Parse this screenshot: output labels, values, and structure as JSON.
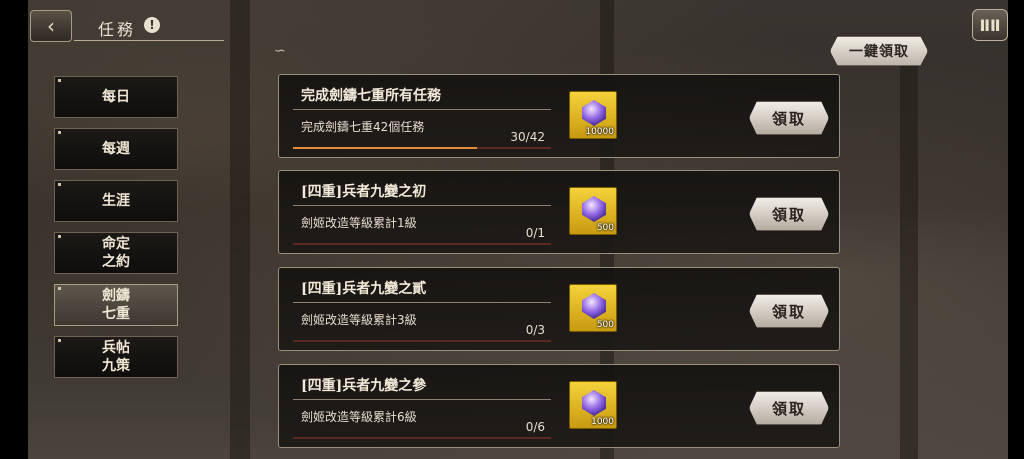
{
  "header": {
    "title": "任務",
    "info_icon": "!",
    "back_icon": "back-arrow",
    "menu_icon": "menu-grid",
    "claim_all_label": "一鍵領取"
  },
  "sidebar": {
    "tabs": [
      {
        "label": "每日",
        "active": false
      },
      {
        "label": "每週",
        "active": false
      },
      {
        "label": "生涯",
        "active": false
      },
      {
        "label": "命定\n之約",
        "active": false
      },
      {
        "label": "劍鑄\n七重",
        "active": true
      },
      {
        "label": "兵帖\n九策",
        "active": false
      }
    ]
  },
  "quests": [
    {
      "title": "完成劍鑄七重所有任務",
      "desc": "完成劍鑄七重42個任務",
      "progress": "30/42",
      "progress_fraction": 0.714,
      "reward_amount": "10000",
      "claim_label": "領取"
    },
    {
      "title": "[四重]兵者九變之初",
      "desc": "劍姬改造等級累計1級",
      "progress": "0/1",
      "progress_fraction": 0,
      "reward_amount": "500",
      "claim_label": "領取"
    },
    {
      "title": "[四重]兵者九變之貳",
      "desc": "劍姬改造等級累計3級",
      "progress": "0/3",
      "progress_fraction": 0,
      "reward_amount": "500",
      "claim_label": "領取"
    },
    {
      "title": "[四重]兵者九變之參",
      "desc": "劍姬改造等級累計6級",
      "progress": "0/6",
      "progress_fraction": 0,
      "reward_amount": "1000",
      "claim_label": "領取"
    }
  ],
  "colors": {
    "progress_fill": "#e48a3a",
    "progress_track": "#5a2a22",
    "reward_bg": "#f4d23a"
  }
}
